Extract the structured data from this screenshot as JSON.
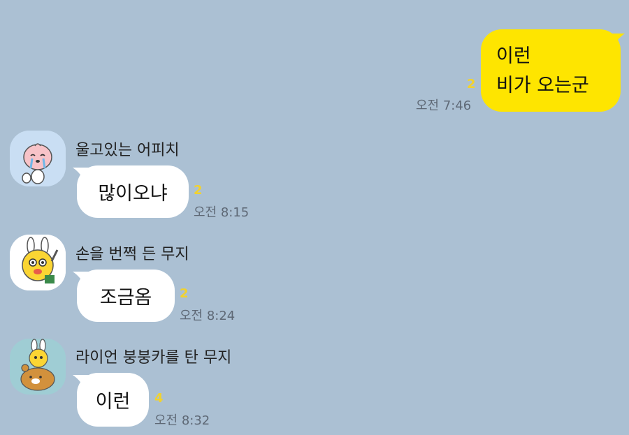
{
  "colors": {
    "background": "#abc0d3",
    "outgoing_bubble": "#fee500",
    "incoming_bubble": "#ffffff",
    "unread": "#f2d22e"
  },
  "outgoing": {
    "lines": [
      "이런",
      "비가 오는군"
    ],
    "unread": "2",
    "time": "오전 7:46"
  },
  "messages": [
    {
      "sender": "울고있는 어피치",
      "avatar_icon": "crying-apeach-icon",
      "text": "많이오냐",
      "unread": "2",
      "time": "오전 8:15"
    },
    {
      "sender": "손을 번쩍 든 무지",
      "avatar_icon": "muzi-raising-hand-icon",
      "text": "조금옴",
      "unread": "2",
      "time": "오전 8:24"
    },
    {
      "sender": "라이언 붕붕카를 탄 무지",
      "avatar_icon": "muzi-riding-ryan-icon",
      "text": "이런",
      "unread": "4",
      "time": "오전 8:32"
    }
  ]
}
